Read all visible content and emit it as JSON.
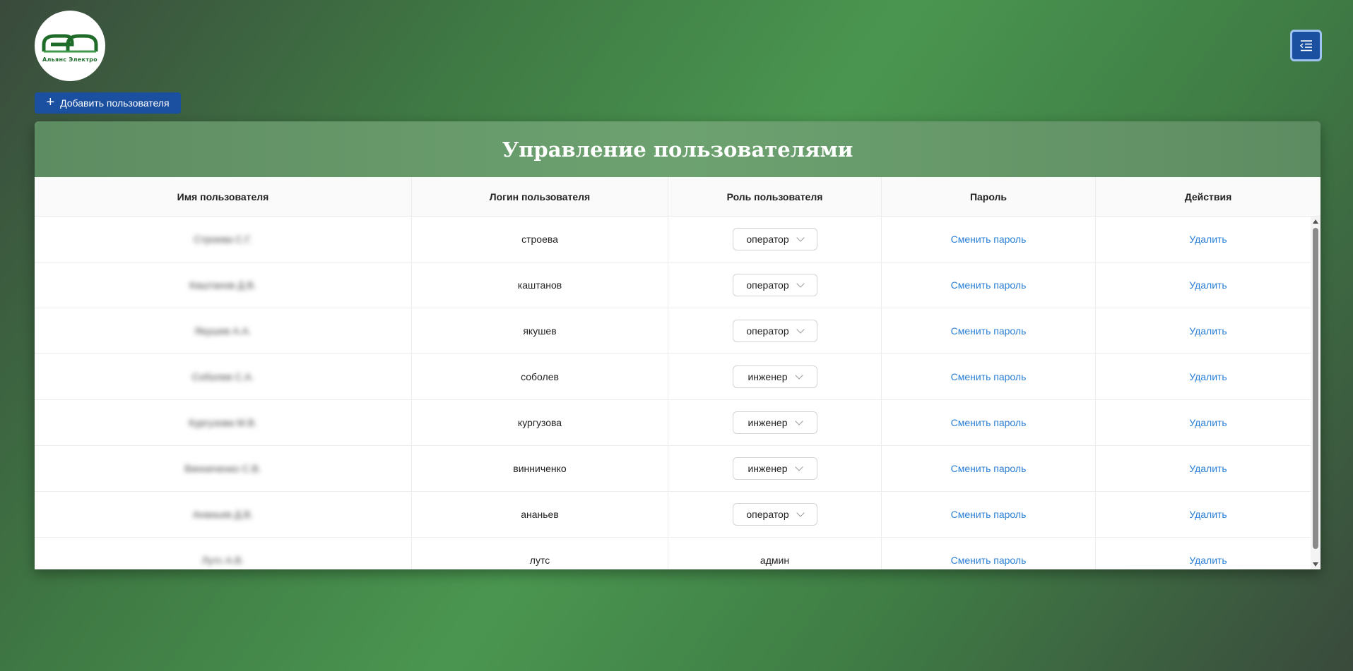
{
  "logo": {
    "text": "Альянс  Электро",
    "color": "#1e6b2a"
  },
  "menu_button": {
    "icon": "menu-collapse-icon"
  },
  "add_user_button": {
    "icon": "plus-icon",
    "label": "Добавить пользователя"
  },
  "title": "Управление пользователями",
  "columns": [
    "Имя пользователя",
    "Логин пользователя",
    "Роль пользователя",
    "Пароль",
    "Действия"
  ],
  "rows": [
    {
      "name": "Строева С.Г.",
      "login": "строева",
      "role": "оператор",
      "role_editable": true,
      "password_action": "Сменить пароль",
      "action": "Удалить"
    },
    {
      "name": "Каштанов Д.В.",
      "login": "каштанов",
      "role": "оператор",
      "role_editable": true,
      "password_action": "Сменить пароль",
      "action": "Удалить"
    },
    {
      "name": "Якушев А.А.",
      "login": "якушев",
      "role": "оператор",
      "role_editable": true,
      "password_action": "Сменить пароль",
      "action": "Удалить"
    },
    {
      "name": "Соболев С.А.",
      "login": "соболев",
      "role": "инженер",
      "role_editable": true,
      "password_action": "Сменить пароль",
      "action": "Удалить"
    },
    {
      "name": "Кургузова М.В.",
      "login": "кургузова",
      "role": "инженер",
      "role_editable": true,
      "password_action": "Сменить пароль",
      "action": "Удалить"
    },
    {
      "name": "Винниченко С.В.",
      "login": "винниченко",
      "role": "инженер",
      "role_editable": true,
      "password_action": "Сменить пароль",
      "action": "Удалить"
    },
    {
      "name": "Ананьев Д.В.",
      "login": "ананьев",
      "role": "оператор",
      "role_editable": true,
      "password_action": "Сменить пароль",
      "action": "Удалить"
    },
    {
      "name": "Лутс А.В.",
      "login": "лутс",
      "role": "админ",
      "role_editable": false,
      "password_action": "Сменить пароль",
      "action": "Удалить"
    }
  ],
  "colors": {
    "accent": "#1b4fa0",
    "link": "#2a7fd6",
    "header": "#6da270"
  }
}
